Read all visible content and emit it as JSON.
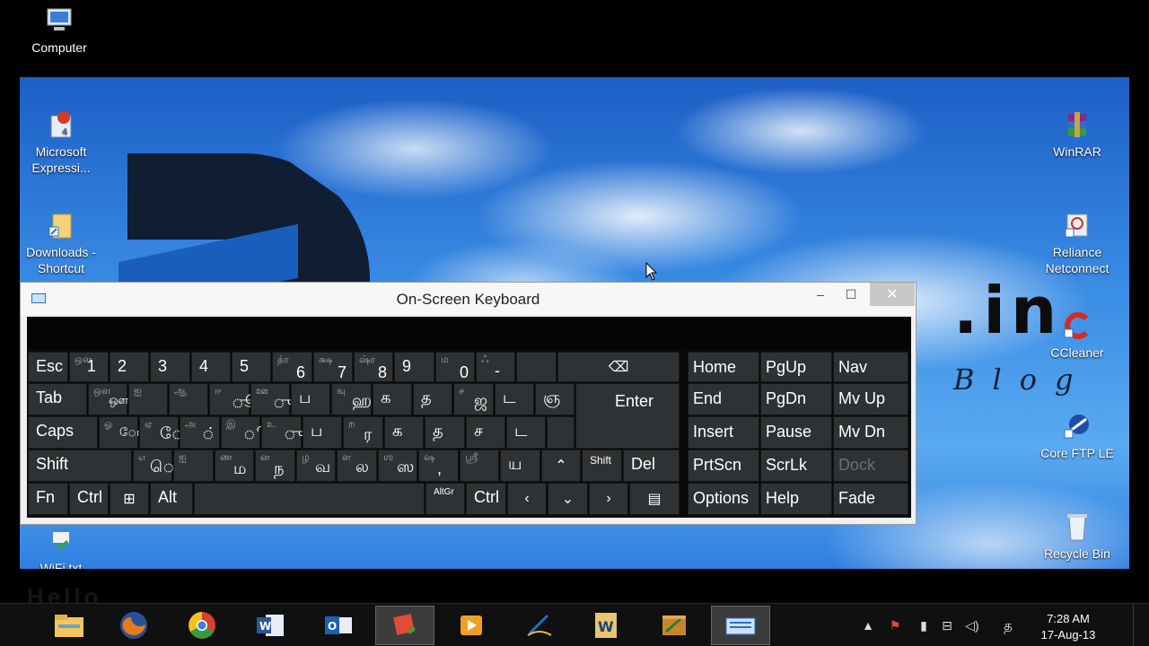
{
  "desktop_icons": {
    "computer": "Computer",
    "ms_expression": "Microsoft Expressi...",
    "downloads": "Downloads - Shortcut",
    "wifi": "WiFi.txt",
    "winrar": "WinRAR",
    "reliance": "Reliance Netconnect",
    "ccleaner": "CCleaner",
    "coreftp": "Core FTP LE",
    "recycle": "Recycle Bin"
  },
  "wallpaper": {
    "in_text": ".in",
    "blog_text": "Blog"
  },
  "osk": {
    "title": "On-Screen Keyboard",
    "minimize": "–",
    "maximize": "☐",
    "close": "✕",
    "keys": {
      "esc": "Esc",
      "n1": "1",
      "n2": "2",
      "n3": "3",
      "n4": "4",
      "n5": "5",
      "n6": "6",
      "n7": "7",
      "n8": "8",
      "n9": "9",
      "n0": "0",
      "minus": "-",
      "n1_alt": "ஒள",
      "n6_alt": "த்ர",
      "n7_alt": "க்ஷ",
      "n8_alt": "ஷ்ர",
      "n0_alt": "ம",
      "minus_alt": "ஃ",
      "tab": "Tab",
      "q": "ஔ",
      "w": "ஐ",
      "e": "ஆ",
      "r": "ஈ",
      "t": "ஊ",
      "y": "ப",
      "u": "ஹ",
      "i": "க",
      "o": "த",
      "p": "ஜ",
      "lbr": "ட",
      "rbr": "ஞ",
      "q_alt": "ஒள",
      "w_alt": "ஐ",
      "e_alt": "ஆ",
      "r_alt": "ஈ",
      "t_alt": "ஊ",
      "u_alt": "ஙு",
      "p_alt": "ச",
      "r_main": "ூ",
      "t_main": "ு",
      "u_main": "ஹ",
      "enter": "Enter",
      "caps": "Caps",
      "a": "ோ",
      "s": "ே",
      "d": "்",
      "f": "ி",
      "g": "ு",
      "h": "ப",
      "j": "ர",
      "k": "க",
      "l": "த",
      "semi": "ச",
      "quote": "ட",
      "a_alt": "ஓ",
      "s_alt": "ஏ",
      "d_alt": "அ",
      "f_alt": "இ",
      "g_alt": "உ",
      "j_alt": "ற",
      "shift": "Shift",
      "z": "ெ",
      "x": "ை",
      "c": "ம",
      "v": "ந",
      "b": "வ",
      "n": "ல",
      "m": "ஸ",
      "comma": ",",
      "period": "ஜ",
      "slash": "ய",
      "z_alt": "எ",
      "x_alt": "ஐ",
      "c_alt": "ண",
      "v_alt": "ன",
      "b_alt": "ழ",
      "n_alt": "ள",
      "m_alt": "ஶ",
      "comma_alt": "ஷ",
      "period_alt": "ஸ்ரீ",
      "up": "⌃",
      "shift_r": "Shift",
      "del": "Del",
      "fn": "Fn",
      "ctrl": "Ctrl",
      "win": "⊞",
      "alt": "Alt",
      "altgr": "AltGr",
      "ctrl_r": "Ctrl",
      "left": "‹",
      "down": "⌄",
      "right": "›",
      "menu": "▤",
      "home": "Home",
      "pgup": "PgUp",
      "nav": "Nav",
      "end": "End",
      "pgdn": "PgDn",
      "mvup": "Mv Up",
      "insert": "Insert",
      "pause": "Pause",
      "mvdn": "Mv Dn",
      "prtscn": "PrtScn",
      "scrlk": "ScrLk",
      "dock": "Dock",
      "options": "Options",
      "help": "Help",
      "fade": "Fade",
      "backspace": "⌫"
    }
  },
  "taskbar": {
    "clock_time": "7:28 AM",
    "clock_date": "17-Aug-13",
    "lang": "த",
    "faded_text": "Hello"
  },
  "colors": {
    "key": "#2f3234",
    "key_sub": "#9da3a8",
    "taskbar": "#101010"
  }
}
